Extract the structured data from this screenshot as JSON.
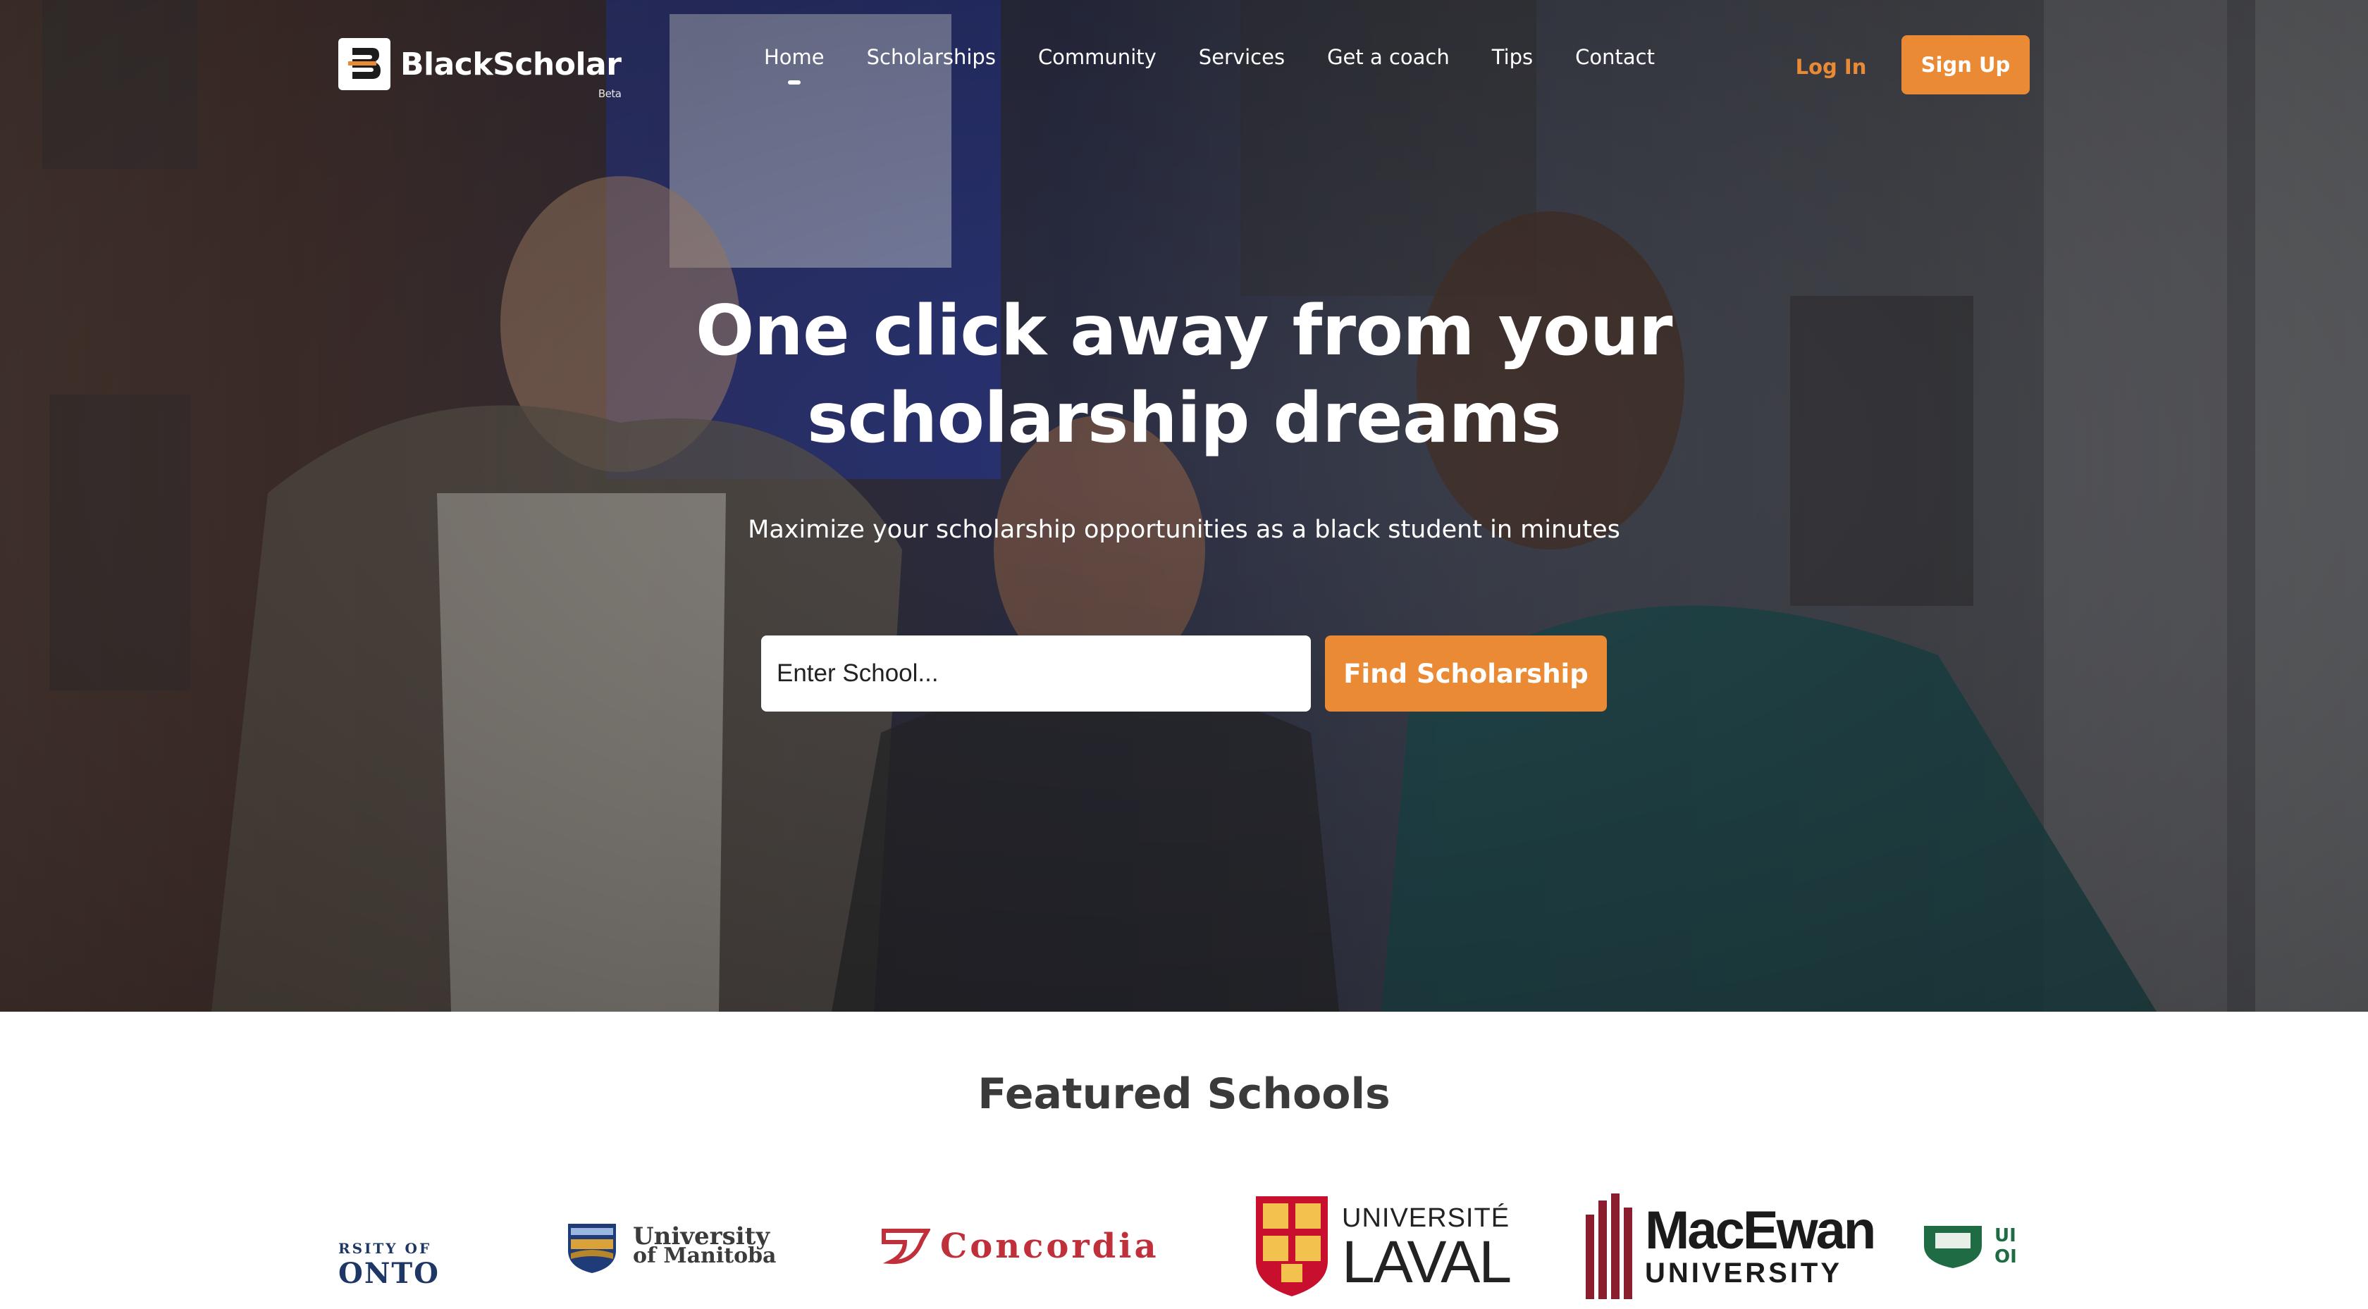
{
  "brand": {
    "name": "BlackScholar",
    "badge": "Beta",
    "accent": "#ea8a34"
  },
  "nav": {
    "items": [
      {
        "label": "Home",
        "active": true
      },
      {
        "label": "Scholarships"
      },
      {
        "label": "Community"
      },
      {
        "label": "Services"
      },
      {
        "label": "Get a coach"
      },
      {
        "label": "Tips"
      },
      {
        "label": "Contact"
      }
    ],
    "login": "Log In",
    "signup": "Sign Up"
  },
  "hero": {
    "headline_line1": "One click away from your",
    "headline_line2": "scholarship dreams",
    "subtitle": "Maximize your scholarship opportunities as a black student in minutes",
    "search_placeholder": "Enter School...",
    "button": "Find Scholarship"
  },
  "featured": {
    "title": "Featured Schools",
    "schools": [
      {
        "line1": "RSITY OF",
        "line2": "ONTO"
      },
      {
        "line1": "University",
        "line2": "of Manitoba"
      },
      {
        "line1": "Concordia"
      },
      {
        "line1": "UNIVERSITÉ",
        "line2": "LAVAL"
      },
      {
        "line1": "MacEwan",
        "line2": "UNIVERSITY"
      },
      {
        "line1": "UI",
        "line2": "OI"
      }
    ]
  }
}
